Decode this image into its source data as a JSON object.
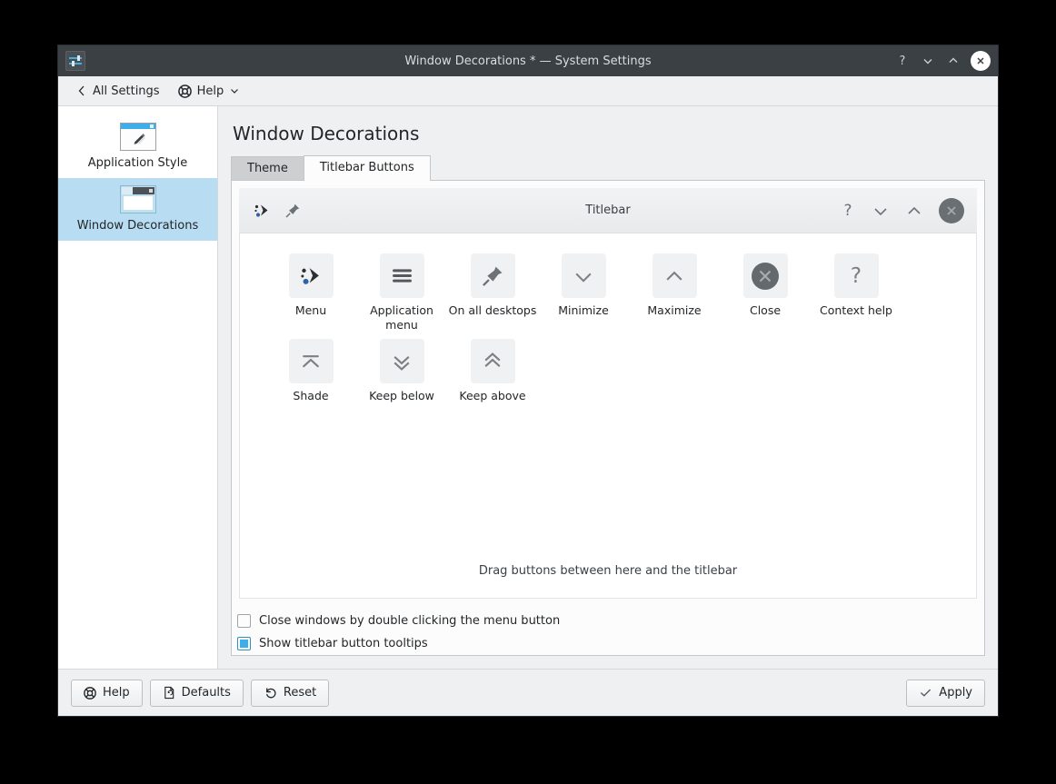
{
  "window": {
    "title": "Window Decorations * — System Settings",
    "app_icon": "settings-sliders-icon",
    "controls": {
      "help": "?",
      "minimize": "chevron-down-icon",
      "maximize": "chevron-up-icon",
      "close": "close-icon"
    }
  },
  "toolbar": {
    "back_label": "All Settings",
    "help_label": "Help"
  },
  "sidebar": {
    "items": [
      {
        "label": "Application Style",
        "icon": "application-style-icon",
        "selected": false
      },
      {
        "label": "Window Decorations",
        "icon": "window-decorations-icon",
        "selected": true
      }
    ]
  },
  "main": {
    "page_title": "Window Decorations",
    "tabs": [
      {
        "label": "Theme",
        "active": false
      },
      {
        "label": "Titlebar Buttons",
        "active": true
      }
    ]
  },
  "preview": {
    "title": "Titlebar",
    "left_buttons": [
      {
        "name": "menu-icon"
      },
      {
        "name": "pin-icon"
      }
    ],
    "right_buttons": [
      {
        "name": "context-help-icon",
        "glyph": "?"
      },
      {
        "name": "minimize-icon"
      },
      {
        "name": "maximize-icon"
      },
      {
        "name": "close-icon"
      }
    ]
  },
  "palette": {
    "drag_hint": "Drag buttons between here and the titlebar",
    "rows": [
      [
        {
          "label": "Menu",
          "icon": "menu-icon"
        },
        {
          "label": "Application menu",
          "icon": "application-menu-icon"
        },
        {
          "label": "On all desktops",
          "icon": "pin-icon"
        },
        {
          "label": "Minimize",
          "icon": "chevron-down-icon"
        },
        {
          "label": "Maximize",
          "icon": "chevron-up-icon"
        },
        {
          "label": "Close",
          "icon": "close-circle-icon"
        },
        {
          "label": "Context help",
          "icon": "question-mark-icon"
        }
      ],
      [
        {
          "label": "Shade",
          "icon": "shade-icon"
        },
        {
          "label": "Keep below",
          "icon": "double-chevron-down-icon"
        },
        {
          "label": "Keep above",
          "icon": "double-chevron-up-icon"
        }
      ]
    ]
  },
  "options": [
    {
      "label": "Close windows by double clicking the menu button",
      "checked": false
    },
    {
      "label": "Show titlebar button tooltips",
      "checked": true
    }
  ],
  "footer": {
    "help_label": "Help",
    "defaults_label": "Defaults",
    "reset_label": "Reset",
    "apply_label": "Apply"
  },
  "colors": {
    "accent": "#3daee9",
    "titlebar_bg": "#3b4045",
    "selection": "#b8dcf2",
    "window_bg": "#eff0f1",
    "close_button": "#6a6f73"
  }
}
